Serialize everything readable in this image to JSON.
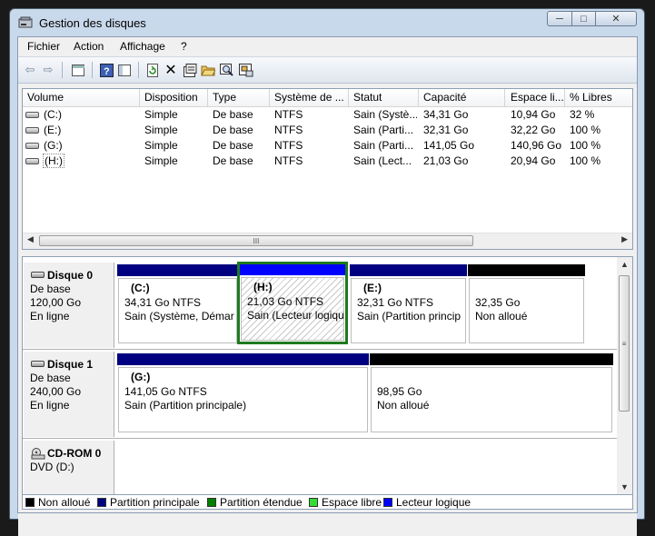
{
  "window": {
    "title": "Gestion des disques",
    "controls": {
      "minimize": "─",
      "maximize": "□",
      "close": "✕"
    }
  },
  "menu": {
    "items": [
      "Fichier",
      "Action",
      "Affichage",
      "?"
    ]
  },
  "toolbar": {
    "icons": [
      "back-icon",
      "forward-icon",
      "properties-pane-icon",
      "help-icon",
      "console-icon",
      "refresh-icon",
      "delete-icon",
      "properties-icon",
      "open-icon",
      "explore-icon",
      "settings-icon"
    ]
  },
  "volume_list": {
    "columns": [
      "Volume",
      "Disposition",
      "Type",
      "Système de ...",
      "Statut",
      "Capacité",
      "Espace li...",
      "% Libres"
    ],
    "rows": [
      {
        "volume": "(C:)",
        "disposition": "Simple",
        "type": "De base",
        "fs": "NTFS",
        "status": "Sain (Systè...",
        "capacity": "34,31 Go",
        "free": "10,94 Go",
        "pct": "32 %"
      },
      {
        "volume": "(E:)",
        "disposition": "Simple",
        "type": "De base",
        "fs": "NTFS",
        "status": "Sain (Parti...",
        "capacity": "32,31 Go",
        "free": "32,22 Go",
        "pct": "100 %"
      },
      {
        "volume": "(G:)",
        "disposition": "Simple",
        "type": "De base",
        "fs": "NTFS",
        "status": "Sain (Parti...",
        "capacity": "141,05 Go",
        "free": "140,96 Go",
        "pct": "100 %"
      },
      {
        "volume": "(H:)",
        "disposition": "Simple",
        "type": "De base",
        "fs": "NTFS",
        "status": "Sain (Lect...",
        "capacity": "21,03 Go",
        "free": "20,94 Go",
        "pct": "100 %"
      }
    ],
    "scroll_thumb": "III"
  },
  "disks": [
    {
      "name": "Disque 0",
      "kind": "De base",
      "size": "120,00 Go",
      "state": "En ligne",
      "partitions": [
        {
          "name": "(C:)",
          "line1": "34,31 Go NTFS",
          "line2": "Sain (Système, Démar",
          "color": "#000080"
        },
        {
          "name": "(H:)",
          "line1": "21,03 Go NTFS",
          "line2": "Sain (Lecteur logiqu",
          "color": "#0000ff",
          "selected": true
        },
        {
          "name": "(E:)",
          "line1": "32,31 Go NTFS",
          "line2": "Sain (Partition princip",
          "color": "#000080"
        },
        {
          "name": "",
          "line1": "32,35 Go",
          "line2": "Non alloué",
          "color": "#000000"
        }
      ]
    },
    {
      "name": "Disque 1",
      "kind": "De base",
      "size": "240,00 Go",
      "state": "En ligne",
      "partitions": [
        {
          "name": "(G:)",
          "line1": "141,05 Go NTFS",
          "line2": "Sain (Partition principale)",
          "color": "#000080"
        },
        {
          "name": "",
          "line1": "98,95 Go",
          "line2": "Non alloué",
          "color": "#000000"
        }
      ]
    },
    {
      "name": "CD-ROM 0",
      "kind": "DVD (D:)"
    }
  ],
  "legend": [
    {
      "label": "Non alloué",
      "color": "#000000"
    },
    {
      "label": "Partition principale",
      "color": "#000080"
    },
    {
      "label": "Partition étendue",
      "color": "#008000"
    },
    {
      "label": "Espace libre",
      "color": "#33dd33"
    },
    {
      "label": "Lecteur logique",
      "color": "#0000ff"
    }
  ]
}
